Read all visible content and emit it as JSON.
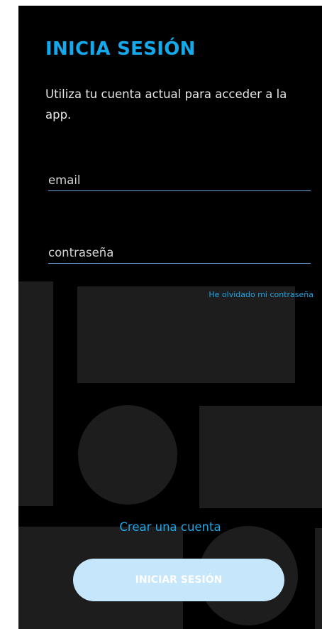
{
  "login": {
    "title": "INICIA SESIÓN",
    "subtitle": "Utiliza tu cuenta actual para acceder a la app.",
    "email_placeholder": "email",
    "password_placeholder": "contraseña",
    "forgot_password": "He olvidado mi contraseña",
    "create_account": "Crear una cuenta",
    "submit_label": "INICIAR SESIÓN"
  },
  "colors": {
    "background": "#000000",
    "accent": "#14a9ec",
    "field_underline": "#6fa8dc",
    "button_fill": "#c5e6fb",
    "decor_shapes": "#1d1d1d"
  }
}
